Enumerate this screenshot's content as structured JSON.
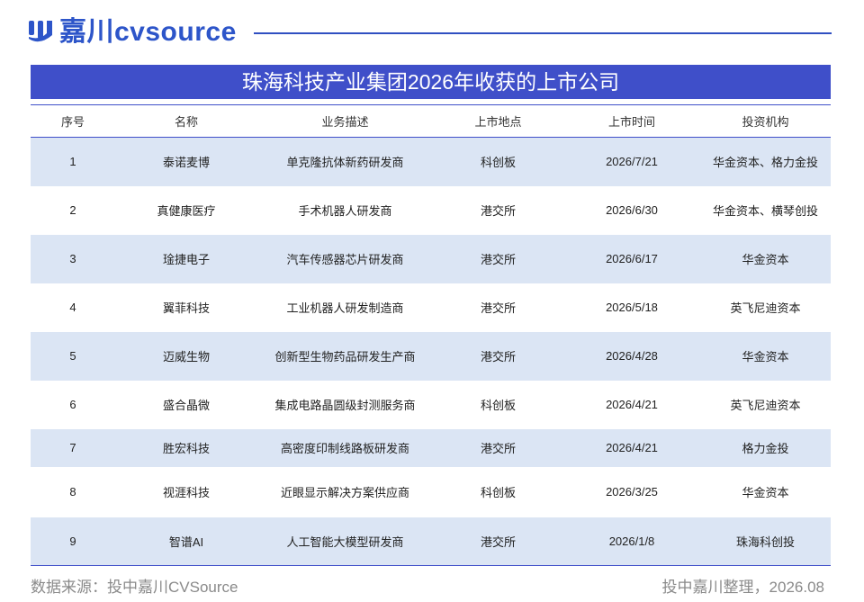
{
  "brand": {
    "logo_text": "嘉川cvsource",
    "accent_color": "#3f4fc9",
    "logo_color": "#2d55c9"
  },
  "title": "珠海科技产业集团2026年收获的上市公司",
  "table": {
    "headers": [
      "序号",
      "名称",
      "业务描述",
      "上市地点",
      "上市时间",
      "投资机构"
    ],
    "rows": [
      [
        "1",
        "泰诺麦博",
        "单克隆抗体新药研发商",
        "科创板",
        "2026/7/21",
        "华金资本、格力金投"
      ],
      [
        "2",
        "真健康医疗",
        "手术机器人研发商",
        "港交所",
        "2026/6/30",
        "华金资本、横琴创投"
      ],
      [
        "3",
        "琻捷电子",
        "汽车传感器芯片研发商",
        "港交所",
        "2026/6/17",
        "华金资本"
      ],
      [
        "4",
        "翼菲科技",
        "工业机器人研发制造商",
        "港交所",
        "2026/5/18",
        "英飞尼迪资本"
      ],
      [
        "5",
        "迈威生物",
        "创新型生物药品研发生产商",
        "港交所",
        "2026/4/28",
        "华金资本"
      ],
      [
        "6",
        "盛合晶微",
        "集成电路晶圆级封测服务商",
        "科创板",
        "2026/4/21",
        "英飞尼迪资本"
      ],
      [
        "7",
        "胜宏科技",
        "高密度印制线路板研发商",
        "港交所",
        "2026/4/21",
        "格力金投"
      ],
      [
        "8",
        "视涯科技",
        "近眼显示解决方案供应商",
        "科创板",
        "2026/3/25",
        "华金资本"
      ],
      [
        "9",
        "智谱AI",
        "人工智能大模型研发商",
        "港交所",
        "2026/1/8",
        "珠海科创投"
      ]
    ]
  },
  "footer": {
    "source": "数据来源：投中嘉川CVSource",
    "credit": "投中嘉川整理，2026.08"
  }
}
